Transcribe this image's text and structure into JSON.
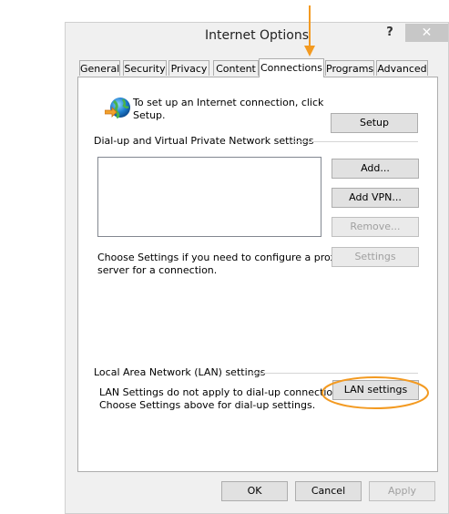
{
  "window": {
    "title": "Internet Options",
    "help_label": "?",
    "close_label": "✕"
  },
  "tabs": [
    {
      "label": "General"
    },
    {
      "label": "Security"
    },
    {
      "label": "Privacy"
    },
    {
      "label": "Content"
    },
    {
      "label": "Connections",
      "active": true
    },
    {
      "label": "Programs"
    },
    {
      "label": "Advanced"
    }
  ],
  "setup": {
    "text_line1": "To set up an Internet connection, click",
    "text_line2": "Setup.",
    "button": "Setup",
    "icon": "globe-connection-icon"
  },
  "dialup": {
    "group_label": "Dial-up and Virtual Private Network settings",
    "add_button": "Add...",
    "add_vpn_button": "Add VPN...",
    "remove_button": "Remove...",
    "settings_button": "Settings",
    "proxy_text_line1": "Choose Settings if you need to configure a proxy",
    "proxy_text_line2": "server for a connection."
  },
  "lan": {
    "group_label": "Local Area Network (LAN) settings",
    "text_line1": "LAN Settings do not apply to dial-up connections.",
    "text_line2": "Choose Settings above for dial-up settings.",
    "button": "LAN settings"
  },
  "footer": {
    "ok": "OK",
    "cancel": "Cancel",
    "apply": "Apply"
  },
  "colors": {
    "annotation": "#f39a21"
  }
}
